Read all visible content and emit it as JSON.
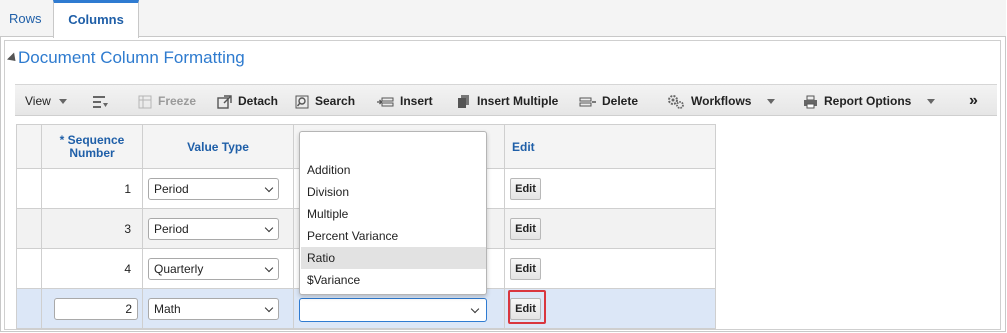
{
  "tabs": [
    {
      "label": "Rows",
      "active": false
    },
    {
      "label": "Columns",
      "active": true
    }
  ],
  "panel": {
    "title": "Document Column Formatting"
  },
  "toolbar": {
    "view": "View",
    "freeze": "Freeze",
    "detach": "Detach",
    "search": "Search",
    "insert": "Insert",
    "insert_multiple": "Insert Multiple",
    "delete": "Delete",
    "workflows": "Workflows",
    "report_options": "Report Options",
    "overflow": "»"
  },
  "table": {
    "headers": {
      "sequence": "* Sequence Number",
      "value_type": "Value Type",
      "edit": "Edit"
    },
    "rows": [
      {
        "sequence": "1",
        "value_type": "Period",
        "edit": "Edit"
      },
      {
        "sequence": "3",
        "value_type": "Period",
        "edit": "Edit"
      },
      {
        "sequence": "4",
        "value_type": "Quarterly",
        "edit": "Edit"
      },
      {
        "sequence": "2",
        "value_type": "Math",
        "edit": "Edit"
      }
    ]
  },
  "dropdown": {
    "options": [
      "Addition",
      "Division",
      "Multiple",
      "Percent Variance",
      "Ratio",
      "$Variance"
    ],
    "highlighted": "Ratio",
    "selected_value": ""
  },
  "colors": {
    "accent": "#2e7bcf",
    "highlight_box": "#d9363e",
    "active_row": "#dce7f7"
  }
}
